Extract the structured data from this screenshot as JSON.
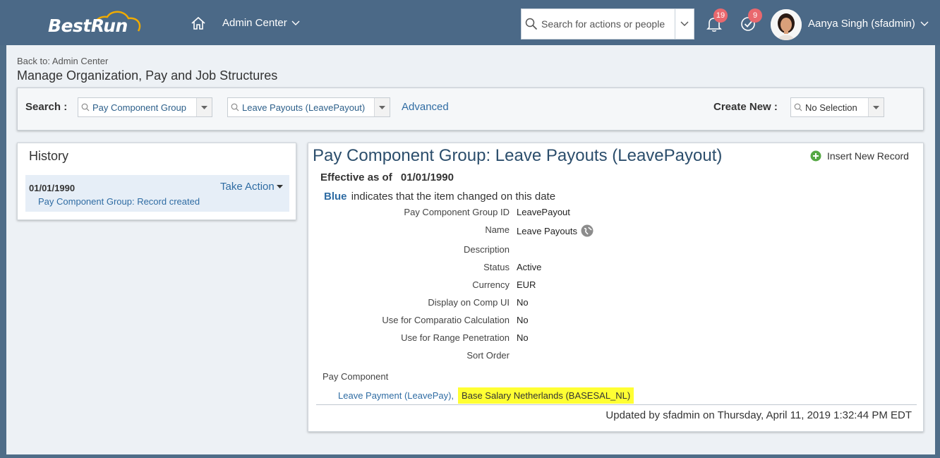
{
  "shell": {
    "logo_text": "BestRun",
    "admin_menu_label": "Admin Center",
    "search_placeholder": "Search for actions or people",
    "notifications_count": "19",
    "tasks_count": "9",
    "user_name": "Aanya Singh (sfadmin)"
  },
  "page": {
    "back_link": "Back to: Admin Center",
    "title": "Manage Organization, Pay and Job Structures"
  },
  "search_panel": {
    "search_label": "Search :",
    "object_type": "Pay Component Group",
    "object_value": "Leave Payouts (LeavePayout)",
    "advanced_label": "Advanced",
    "create_new_label": "Create New :",
    "create_new_value": "No Selection"
  },
  "history": {
    "title": "History",
    "items": [
      {
        "date": "01/01/1990",
        "description": "Pay Component Group: Record created",
        "action_label": "Take Action"
      }
    ]
  },
  "detail": {
    "title": "Pay Component Group: Leave Payouts (LeavePayout)",
    "insert_label": "Insert New Record",
    "effective_label": "Effective as of",
    "effective_date": "01/01/1990",
    "legend_word": "Blue",
    "legend_text": "indicates that the item changed on this date",
    "fields": [
      {
        "label": "Pay Component Group ID",
        "value": "LeavePayout"
      },
      {
        "label": "Name",
        "value": "Leave Payouts"
      },
      {
        "label": "Description",
        "value": ""
      },
      {
        "label": "Status",
        "value": "Active"
      },
      {
        "label": "Currency",
        "value": "EUR"
      },
      {
        "label": "Display on Comp UI",
        "value": "No"
      },
      {
        "label": "Use for Comparatio Calculation",
        "value": "No"
      },
      {
        "label": "Use for Range Penetration",
        "value": "No"
      },
      {
        "label": "Sort Order",
        "value": ""
      }
    ],
    "pay_component_label": "Pay Component",
    "pay_components": [
      {
        "label": "Leave Payment (LeavePay),"
      },
      {
        "label": "Base Salary Netherlands (BASESAL_NL)"
      }
    ],
    "updated_text": "Updated by sfadmin on Thursday, April 11, 2019 1:32:44 PM EDT"
  },
  "colors": {
    "shell_bg": "#4b6987",
    "link_blue": "#2f6ca3",
    "badge_red": "#e9686e",
    "highlight_yellow": "#ffff33"
  }
}
